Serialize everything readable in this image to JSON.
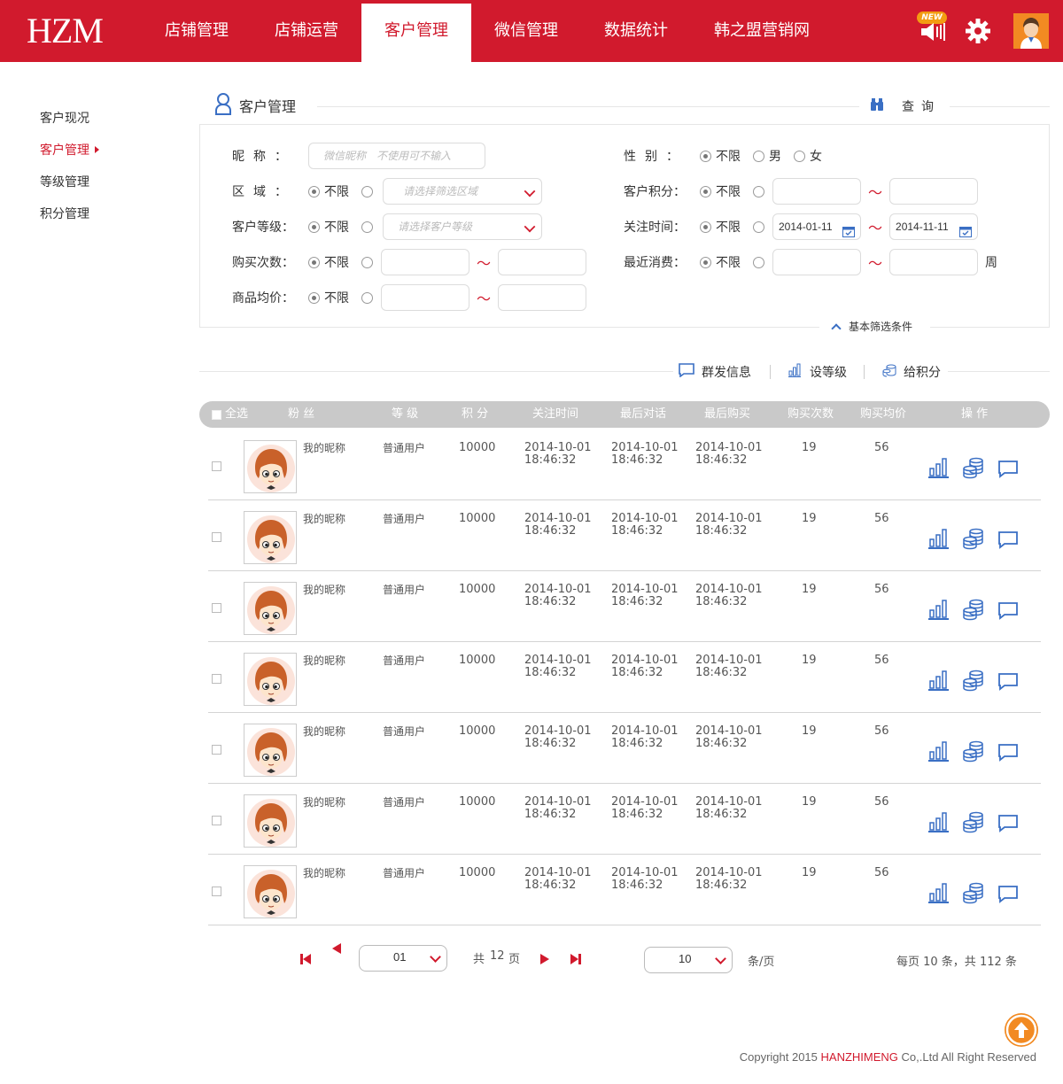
{
  "header": {
    "logo": "HZM",
    "nav": [
      {
        "label": "店铺管理",
        "active": false
      },
      {
        "label": "店铺运营",
        "active": false
      },
      {
        "label": "客户管理",
        "active": true
      },
      {
        "label": "微信管理",
        "active": false
      },
      {
        "label": "数据统计",
        "active": false
      },
      {
        "label": "韩之盟营销网",
        "active": false
      }
    ],
    "new_badge": "NEW",
    "icons": [
      "speaker-icon",
      "gear-icon",
      "user-avatar"
    ]
  },
  "sidebar": {
    "items": [
      {
        "label": "客户现况",
        "active": false
      },
      {
        "label": "客户管理",
        "active": true
      },
      {
        "label": "等级管理",
        "active": false
      },
      {
        "label": "积分管理",
        "active": false
      }
    ]
  },
  "section": {
    "title": "客户管理",
    "query_label": "查询"
  },
  "filters": {
    "nickname": {
      "label": "昵称：",
      "placeholder": "微信昵称　不使用可不输入"
    },
    "gender": {
      "label": "性别：",
      "options": [
        "不限",
        "男",
        "女"
      ],
      "selected": "不限"
    },
    "region": {
      "label": "区域：",
      "unlimited": "不限",
      "placeholder": "请选择筛选区域"
    },
    "points": {
      "label": "客户积分：",
      "unlimited": "不限",
      "from": "",
      "to": ""
    },
    "level": {
      "label": "客户等级：",
      "unlimited": "不限",
      "placeholder": "请选择客户等级"
    },
    "follow_time": {
      "label": "关注时间：",
      "unlimited": "不限",
      "from": "2014-01-11",
      "to": "2014-11-11"
    },
    "purchases": {
      "label": "购买次数：",
      "unlimited": "不限",
      "from": "",
      "to": ""
    },
    "last_purchase": {
      "label": "最近消费：",
      "unlimited": "不限",
      "from": "",
      "to": "",
      "unit": "周"
    },
    "avg_price": {
      "label": "商品均价：",
      "unlimited": "不限",
      "from": "",
      "to": ""
    },
    "tilde": "～",
    "collapse_label": "基本筛选条件"
  },
  "actions": [
    {
      "label": "群发信息",
      "icon": "message-icon"
    },
    {
      "label": "设等级",
      "icon": "bar-chart-icon"
    },
    {
      "label": "给积分",
      "icon": "coins-icon"
    }
  ],
  "table": {
    "columns": [
      "全选",
      "粉 丝",
      "等 级",
      "积 分",
      "关注时间",
      "最后对话",
      "最后购买",
      "购买次数",
      "购买均价",
      "操 作"
    ],
    "rows": [
      {
        "nickname": "我的昵称",
        "level": "普通用户",
        "points": "10000",
        "follow_date": "2014-10-01",
        "follow_time": "18:46:32",
        "chat_date": "2014-10-01",
        "chat_time": "18:46:32",
        "buy_date": "2014-10-01",
        "buy_time": "18:46:32",
        "buy_count": "19",
        "avg_price": "56"
      },
      {
        "nickname": "我的昵称",
        "level": "普通用户",
        "points": "10000",
        "follow_date": "2014-10-01",
        "follow_time": "18:46:32",
        "chat_date": "2014-10-01",
        "chat_time": "18:46:32",
        "buy_date": "2014-10-01",
        "buy_time": "18:46:32",
        "buy_count": "19",
        "avg_price": "56"
      },
      {
        "nickname": "我的昵称",
        "level": "普通用户",
        "points": "10000",
        "follow_date": "2014-10-01",
        "follow_time": "18:46:32",
        "chat_date": "2014-10-01",
        "chat_time": "18:46:32",
        "buy_date": "2014-10-01",
        "buy_time": "18:46:32",
        "buy_count": "19",
        "avg_price": "56"
      },
      {
        "nickname": "我的昵称",
        "level": "普通用户",
        "points": "10000",
        "follow_date": "2014-10-01",
        "follow_time": "18:46:32",
        "chat_date": "2014-10-01",
        "chat_time": "18:46:32",
        "buy_date": "2014-10-01",
        "buy_time": "18:46:32",
        "buy_count": "19",
        "avg_price": "56"
      },
      {
        "nickname": "我的昵称",
        "level": "普通用户",
        "points": "10000",
        "follow_date": "2014-10-01",
        "follow_time": "18:46:32",
        "chat_date": "2014-10-01",
        "chat_time": "18:46:32",
        "buy_date": "2014-10-01",
        "buy_time": "18:46:32",
        "buy_count": "19",
        "avg_price": "56"
      },
      {
        "nickname": "我的昵称",
        "level": "普通用户",
        "points": "10000",
        "follow_date": "2014-10-01",
        "follow_time": "18:46:32",
        "chat_date": "2014-10-01",
        "chat_time": "18:46:32",
        "buy_date": "2014-10-01",
        "buy_time": "18:46:32",
        "buy_count": "19",
        "avg_price": "56"
      },
      {
        "nickname": "我的昵称",
        "level": "普通用户",
        "points": "10000",
        "follow_date": "2014-10-01",
        "follow_time": "18:46:32",
        "chat_date": "2014-10-01",
        "chat_time": "18:46:32",
        "buy_date": "2014-10-01",
        "buy_time": "18:46:32",
        "buy_count": "19",
        "avg_price": "56"
      }
    ]
  },
  "pager": {
    "current_page": "01",
    "total_prefix": "共",
    "total_pages": "12",
    "total_suffix": "页",
    "per_page": "10",
    "per_page_unit": "条/页",
    "summary": "每页 10 条，共 112 条"
  },
  "footer": {
    "copyright_prefix": "Copyright 2015",
    "brand": "HANZHIMENG",
    "copyright_suffix": "Co,.Ltd All Right Reserved"
  },
  "colors": {
    "brand_red": "#d11a2d",
    "accent_blue": "#3a6fc4",
    "orange": "#f28a22"
  }
}
